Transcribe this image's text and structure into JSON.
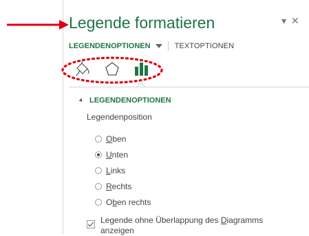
{
  "pane": {
    "title": "Legende formatieren",
    "collapse_icon": "chevron-down-icon",
    "close_icon": "close-icon",
    "collapse_glyph": "▾",
    "close_glyph": "✕"
  },
  "tabs": {
    "legend_options": "LEGENDENOPTIONEN",
    "text_options": "TEXTOPTIONEN"
  },
  "icon_tabs": [
    "fill-line-icon",
    "effects-pentagon-icon",
    "legend-options-bar-icon"
  ],
  "section": {
    "header": "LEGENDENOPTIONEN",
    "position_label": "Legendenposition"
  },
  "positions": [
    {
      "pre": "",
      "ul": "O",
      "post": "ben",
      "selected": false
    },
    {
      "pre": "",
      "ul": "U",
      "post": "nten",
      "selected": true
    },
    {
      "pre": "",
      "ul": "L",
      "post": "inks",
      "selected": false
    },
    {
      "pre": "",
      "ul": "R",
      "post": "echts",
      "selected": false
    },
    {
      "pre": "O",
      "ul": "b",
      "post": "en rechts",
      "selected": false
    }
  ],
  "overlap_checkbox": {
    "pre": "Legende ohne Überlappung des ",
    "ul": "D",
    "post": "iagramms anzeigen",
    "checked": true
  },
  "colors": {
    "accent_green": "#217346",
    "annotation_red": "#e0000f"
  }
}
